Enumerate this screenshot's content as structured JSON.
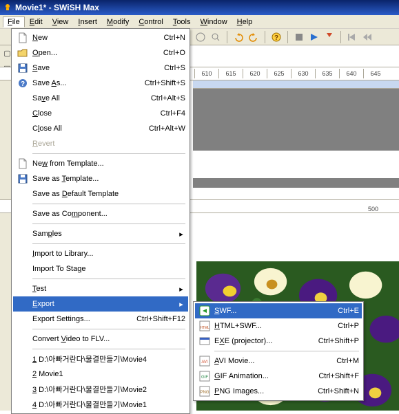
{
  "titlebar": {
    "text": "Movie1* - SWiSH Max"
  },
  "menubar": {
    "items": [
      {
        "html": "<u>F</u>ile",
        "open": true
      },
      {
        "html": "<u>E</u>dit"
      },
      {
        "html": "<u>V</u>iew"
      },
      {
        "html": "<u>I</u>nsert"
      },
      {
        "html": "<u>M</u>odify"
      },
      {
        "html": "<u>C</u>ontrol"
      },
      {
        "html": "<u>T</u>ools"
      },
      {
        "html": "<u>W</u>indow"
      },
      {
        "html": "<u>H</u>elp"
      }
    ]
  },
  "ruler": {
    "ticks": [
      "610",
      "615",
      "620",
      "625",
      "630",
      "635",
      "640",
      "645"
    ]
  },
  "ruler2": {
    "tick": "500"
  },
  "fileMenu": [
    {
      "type": "item",
      "icon": "file",
      "html": "<u>N</u>ew",
      "shortcut": "Ctrl+N"
    },
    {
      "type": "item",
      "icon": "open",
      "html": "<u>O</u>pen...",
      "shortcut": "Ctrl+O"
    },
    {
      "type": "item",
      "icon": "save",
      "html": "<u>S</u>ave",
      "shortcut": "Ctrl+S"
    },
    {
      "type": "item",
      "icon": "help",
      "html": "Save <u>A</u>s...",
      "shortcut": "Ctrl+Shift+S"
    },
    {
      "type": "item",
      "icon": "",
      "html": "Sa<u>v</u>e All",
      "shortcut": "Ctrl+Alt+S"
    },
    {
      "type": "item",
      "icon": "",
      "html": "<u>C</u>lose",
      "shortcut": "Ctrl+F4"
    },
    {
      "type": "item",
      "icon": "",
      "html": "C<u>l</u>ose All",
      "shortcut": "Ctrl+Alt+W"
    },
    {
      "type": "item",
      "icon": "",
      "html": "<u>R</u>evert",
      "disabled": true
    },
    {
      "type": "sep"
    },
    {
      "type": "item",
      "icon": "file",
      "html": "Ne<u>w</u> from Template..."
    },
    {
      "type": "item",
      "icon": "save",
      "html": "Save as <u>T</u>emplate..."
    },
    {
      "type": "item",
      "icon": "",
      "html": "Save as <u>D</u>efault Template"
    },
    {
      "type": "sep"
    },
    {
      "type": "item",
      "icon": "",
      "html": "Save as Co<u>m</u>ponent..."
    },
    {
      "type": "sep"
    },
    {
      "type": "item",
      "icon": "",
      "html": "Sam<u>p</u>les",
      "arrow": true
    },
    {
      "type": "sep"
    },
    {
      "type": "item",
      "icon": "",
      "html": "<u>I</u>mport to Library..."
    },
    {
      "type": "item",
      "icon": "",
      "html": "Import To Sta<u>g</u>e"
    },
    {
      "type": "sep"
    },
    {
      "type": "item",
      "icon": "",
      "html": "<u>T</u>est",
      "arrow": true
    },
    {
      "type": "item",
      "icon": "",
      "html": "<u>E</u>xport",
      "arrow": true,
      "highlight": true
    },
    {
      "type": "item",
      "icon": "",
      "html": "Export Settings...",
      "shortcut": "Ctrl+Shift+F12"
    },
    {
      "type": "sep"
    },
    {
      "type": "item",
      "icon": "",
      "html": "Convert <u>V</u>ideo to FLV..."
    },
    {
      "type": "sep"
    },
    {
      "type": "item",
      "icon": "",
      "html": "<u>1</u> D:\\아빠거란다\\물결만들기\\Movie4"
    },
    {
      "type": "item",
      "icon": "",
      "html": "<u>2</u> Movie1"
    },
    {
      "type": "item",
      "icon": "",
      "html": "<u>3</u> D:\\아빠거란다\\물결만들기\\Movie2"
    },
    {
      "type": "item",
      "icon": "",
      "html": "<u>4</u> D:\\아빠거란다\\물결만들기\\Movie1"
    }
  ],
  "exportSubmenu": [
    {
      "icon": "swf",
      "html": "<u>S</u>WF...",
      "shortcut": "Ctrl+E",
      "highlight": true
    },
    {
      "icon": "html",
      "html": "<u>H</u>TML+SWF...",
      "shortcut": "Ctrl+P"
    },
    {
      "icon": "exe",
      "html": "E<u>X</u>E (projector)...",
      "shortcut": "Ctrl+Shift+P"
    },
    {
      "type": "sep"
    },
    {
      "icon": "avi",
      "html": "<u>A</u>VI Movie...",
      "shortcut": "Ctrl+M"
    },
    {
      "icon": "gif",
      "html": "<u>G</u>IF Animation...",
      "shortcut": "Ctrl+Shift+F"
    },
    {
      "icon": "png",
      "html": "<u>P</u>NG Images...",
      "shortcut": "Ctrl+Shift+N"
    }
  ]
}
